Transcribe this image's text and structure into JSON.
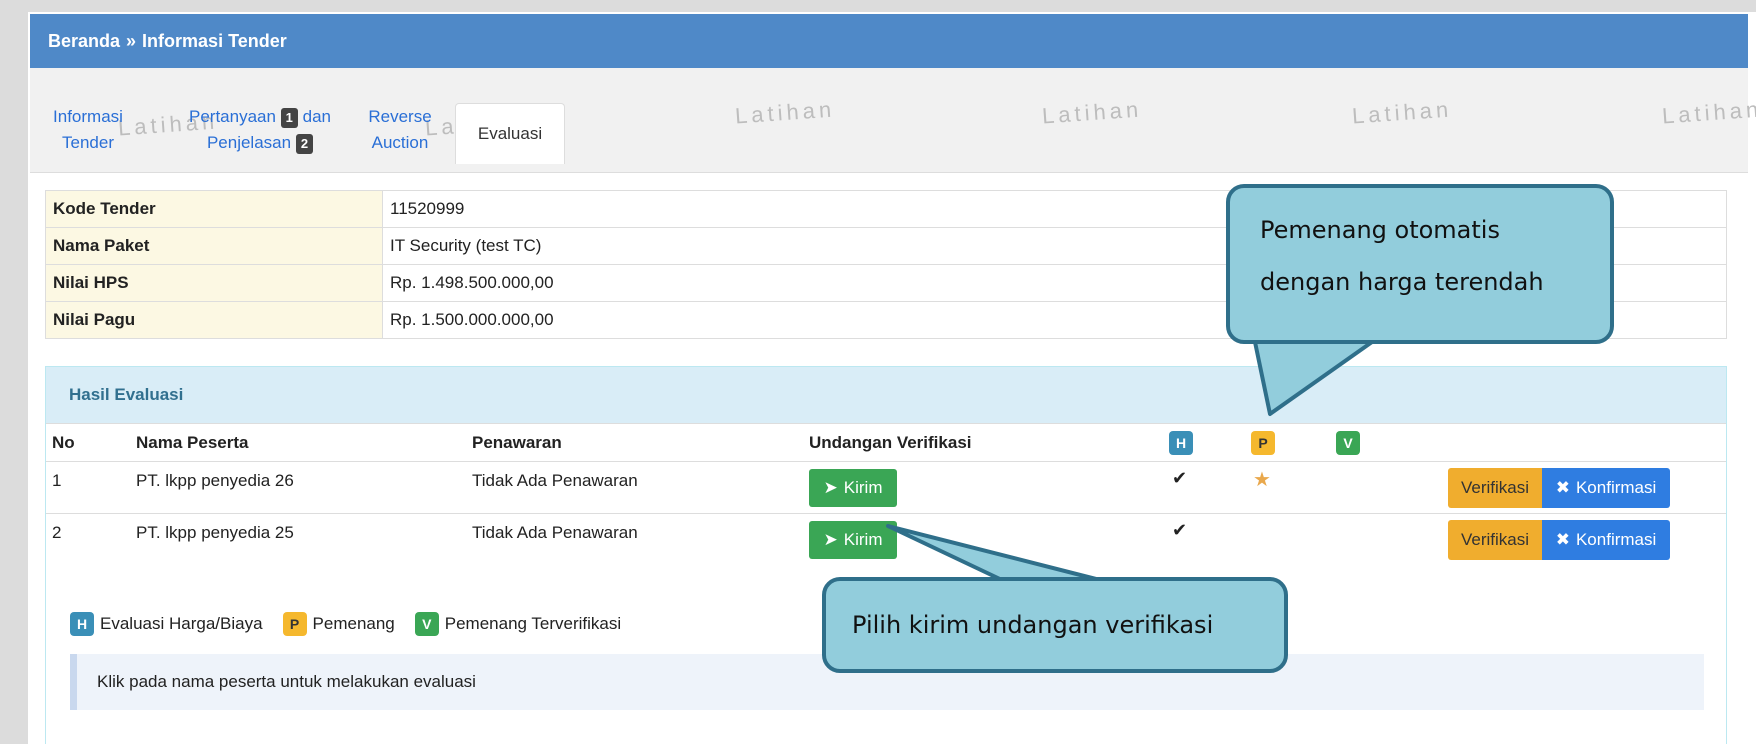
{
  "breadcrumb": {
    "home": "Beranda",
    "separator": "»",
    "current": "Informasi Tender"
  },
  "tabs": [
    {
      "line1": "Informasi",
      "line2": "Tender"
    },
    {
      "line1": "Pertanyaan",
      "badge1": "1",
      "line1b": "dan",
      "line2": "Penjelasan",
      "badge2": "2"
    },
    {
      "line1": "Reverse",
      "line2": "Auction"
    },
    {
      "label": "Evaluasi"
    }
  ],
  "watermark": "Latihan",
  "tender_info": [
    {
      "key": "Kode Tender",
      "value": "11520999"
    },
    {
      "key": "Nama Paket",
      "value": "IT Security (test TC)"
    },
    {
      "key": "Nilai HPS",
      "value": "Rp. 1.498.500.000,00"
    },
    {
      "key": "Nilai Pagu",
      "value": "Rp. 1.500.000.000,00"
    }
  ],
  "evaluation": {
    "title": "Hasil Evaluasi",
    "columns": {
      "no": "No",
      "name": "Nama Peserta",
      "offer": "Penawaran",
      "invite": "Undangan Verifikasi",
      "h": "H",
      "p": "P",
      "v": "V"
    },
    "rows": [
      {
        "no": "1",
        "name": "PT. lkpp penyedia 26",
        "offer": "Tidak Ada Penawaran",
        "kirim": "Kirim",
        "h_check": true,
        "p_star": true
      },
      {
        "no": "2",
        "name": "PT. lkpp penyedia 25",
        "offer": "Tidak Ada Penawaran",
        "kirim": "Kirim",
        "h_check": true,
        "p_star": false
      }
    ],
    "verify_label": "Verifikasi",
    "confirm_label": "Konfirmasi"
  },
  "legend": {
    "h": "Evaluasi Harga/Biaya",
    "p": "Pemenang",
    "v": "Pemenang Terverifikasi"
  },
  "note": "Klik pada nama peserta untuk melakukan evaluasi",
  "callouts": {
    "top_line1": "Pemenang otomatis",
    "top_line2": "dengan harga terendah",
    "bottom": "Pilih kirim undangan verifikasi"
  },
  "colors": {
    "header": "#4f89c8",
    "badge_h": "#3a8fb7",
    "badge_p": "#f5b82e",
    "badge_v": "#3aa655",
    "callout": "#92cddc"
  }
}
